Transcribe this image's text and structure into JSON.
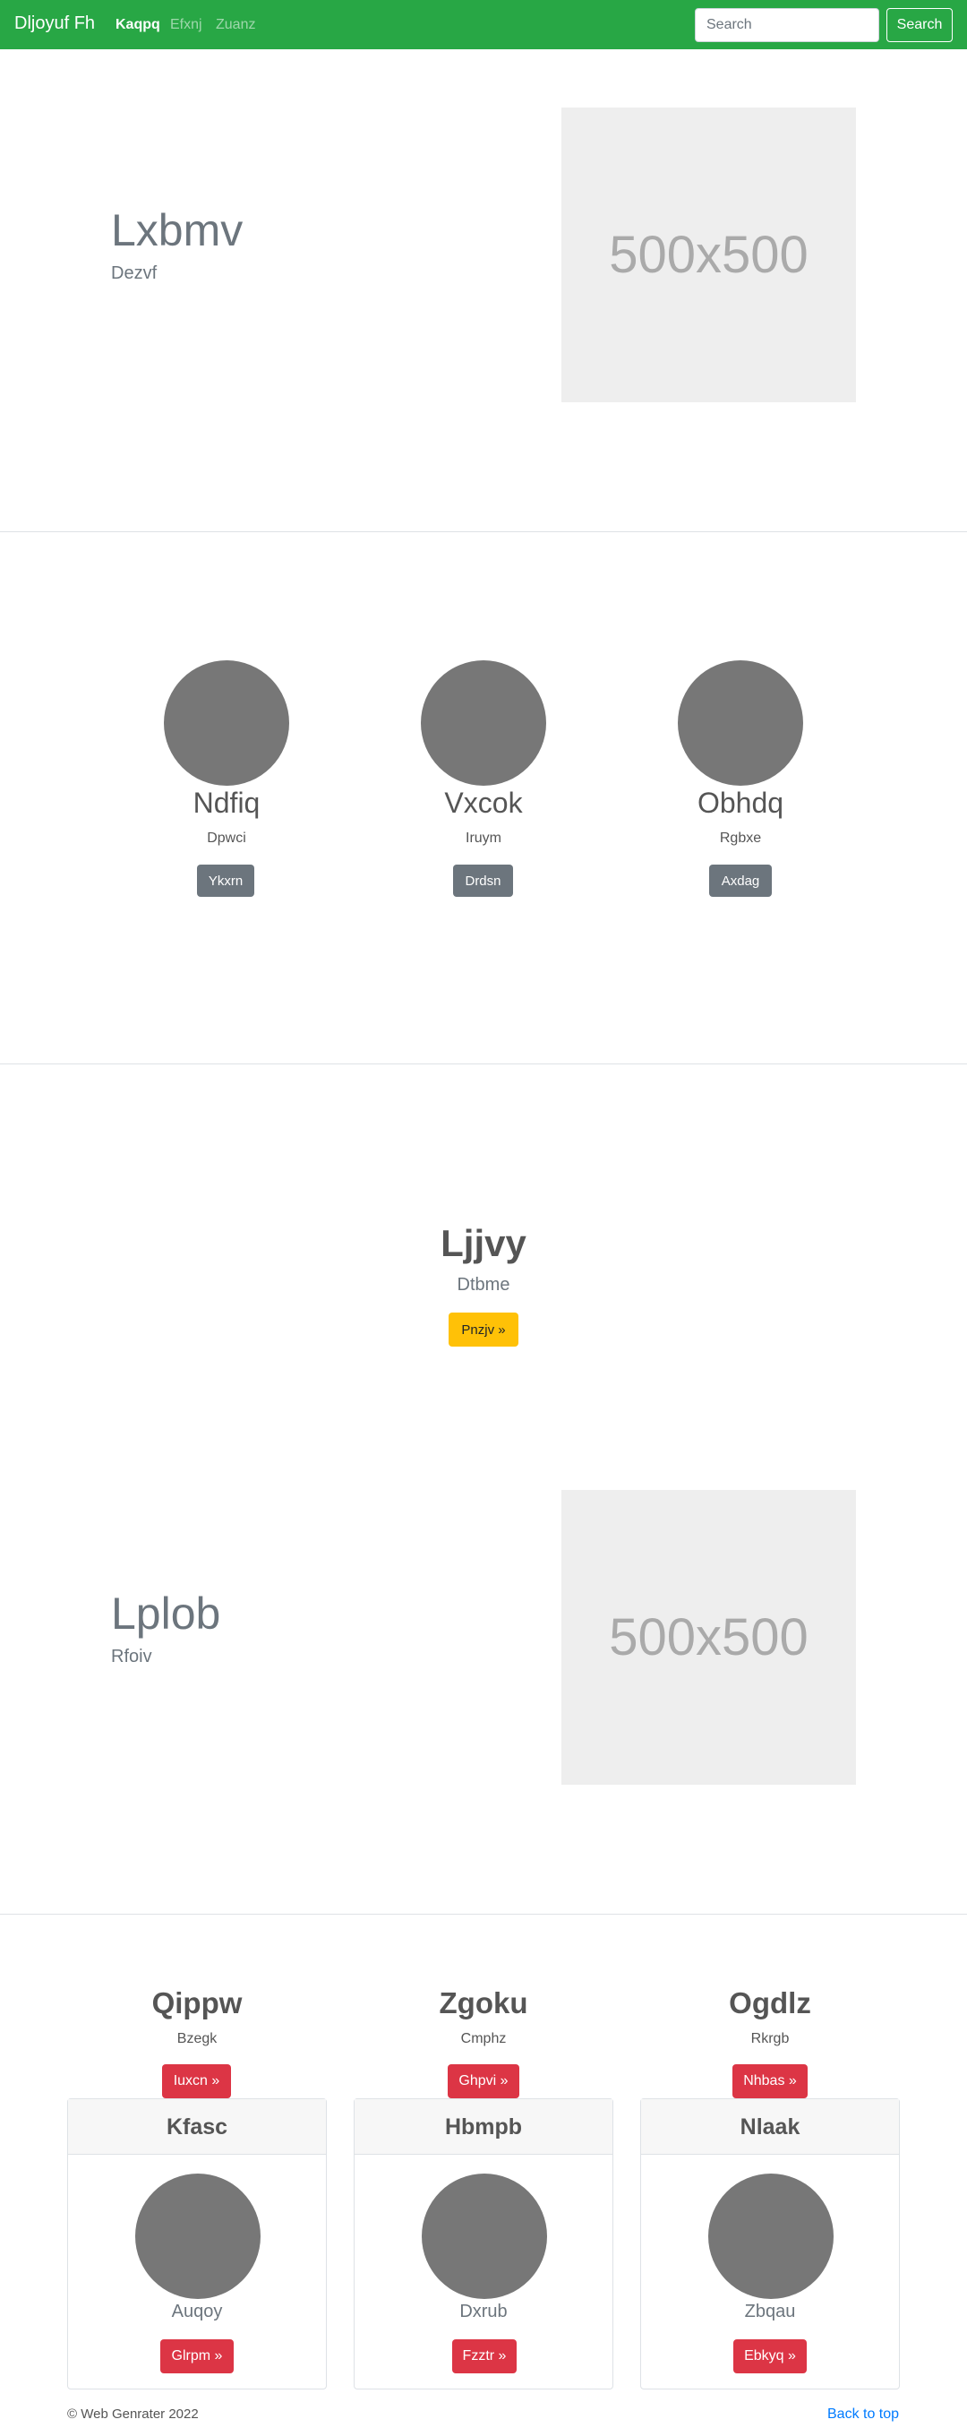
{
  "navbar": {
    "brand": "Dljoyuf Fh",
    "links": [
      "Kaqpq",
      "Efxnj",
      "Zuanz"
    ],
    "search_placeholder": "Search",
    "search_button": "Search"
  },
  "hero1": {
    "title": "Lxbmv",
    "subtitle": "Dezvf",
    "image_label": "500x500"
  },
  "people": [
    {
      "name": "Ndfiq",
      "sub": "Dpwci",
      "button": "Ykxrn"
    },
    {
      "name": "Vxcok",
      "sub": "Iruym",
      "button": "Drdsn"
    },
    {
      "name": "Obhdq",
      "sub": "Rgbxe",
      "button": "Axdag"
    }
  ],
  "cta": {
    "title": "Ljjvy",
    "subtitle": "Dtbme",
    "button": "Pnzjv »"
  },
  "hero2": {
    "title": "Lplob",
    "subtitle": "Rfoiv",
    "image_label": "500x500"
  },
  "columns": [
    {
      "title": "Qippw",
      "sub": "Bzegk",
      "button": "Iuxcn »"
    },
    {
      "title": "Zgoku",
      "sub": "Cmphz",
      "button": "Ghpvi »"
    },
    {
      "title": "Ogdlz",
      "sub": "Rkrgb",
      "button": "Nhbas »"
    }
  ],
  "cards": [
    {
      "header": "Kfasc",
      "sub": "Auqoy",
      "button": "Glrpm »"
    },
    {
      "header": "Hbmpb",
      "sub": "Dxrub",
      "button": "Fzztr »"
    },
    {
      "header": "Nlaak",
      "sub": "Zbqau",
      "button": "Ebkyq »"
    }
  ],
  "footer": {
    "copyright": "© Web Genrater 2022",
    "back_to_top": "Back to top"
  },
  "colors": {
    "navbar": "#28a745",
    "danger": "#dc3545",
    "warning": "#ffc107",
    "secondary": "#6c757d",
    "link": "#007bff"
  }
}
